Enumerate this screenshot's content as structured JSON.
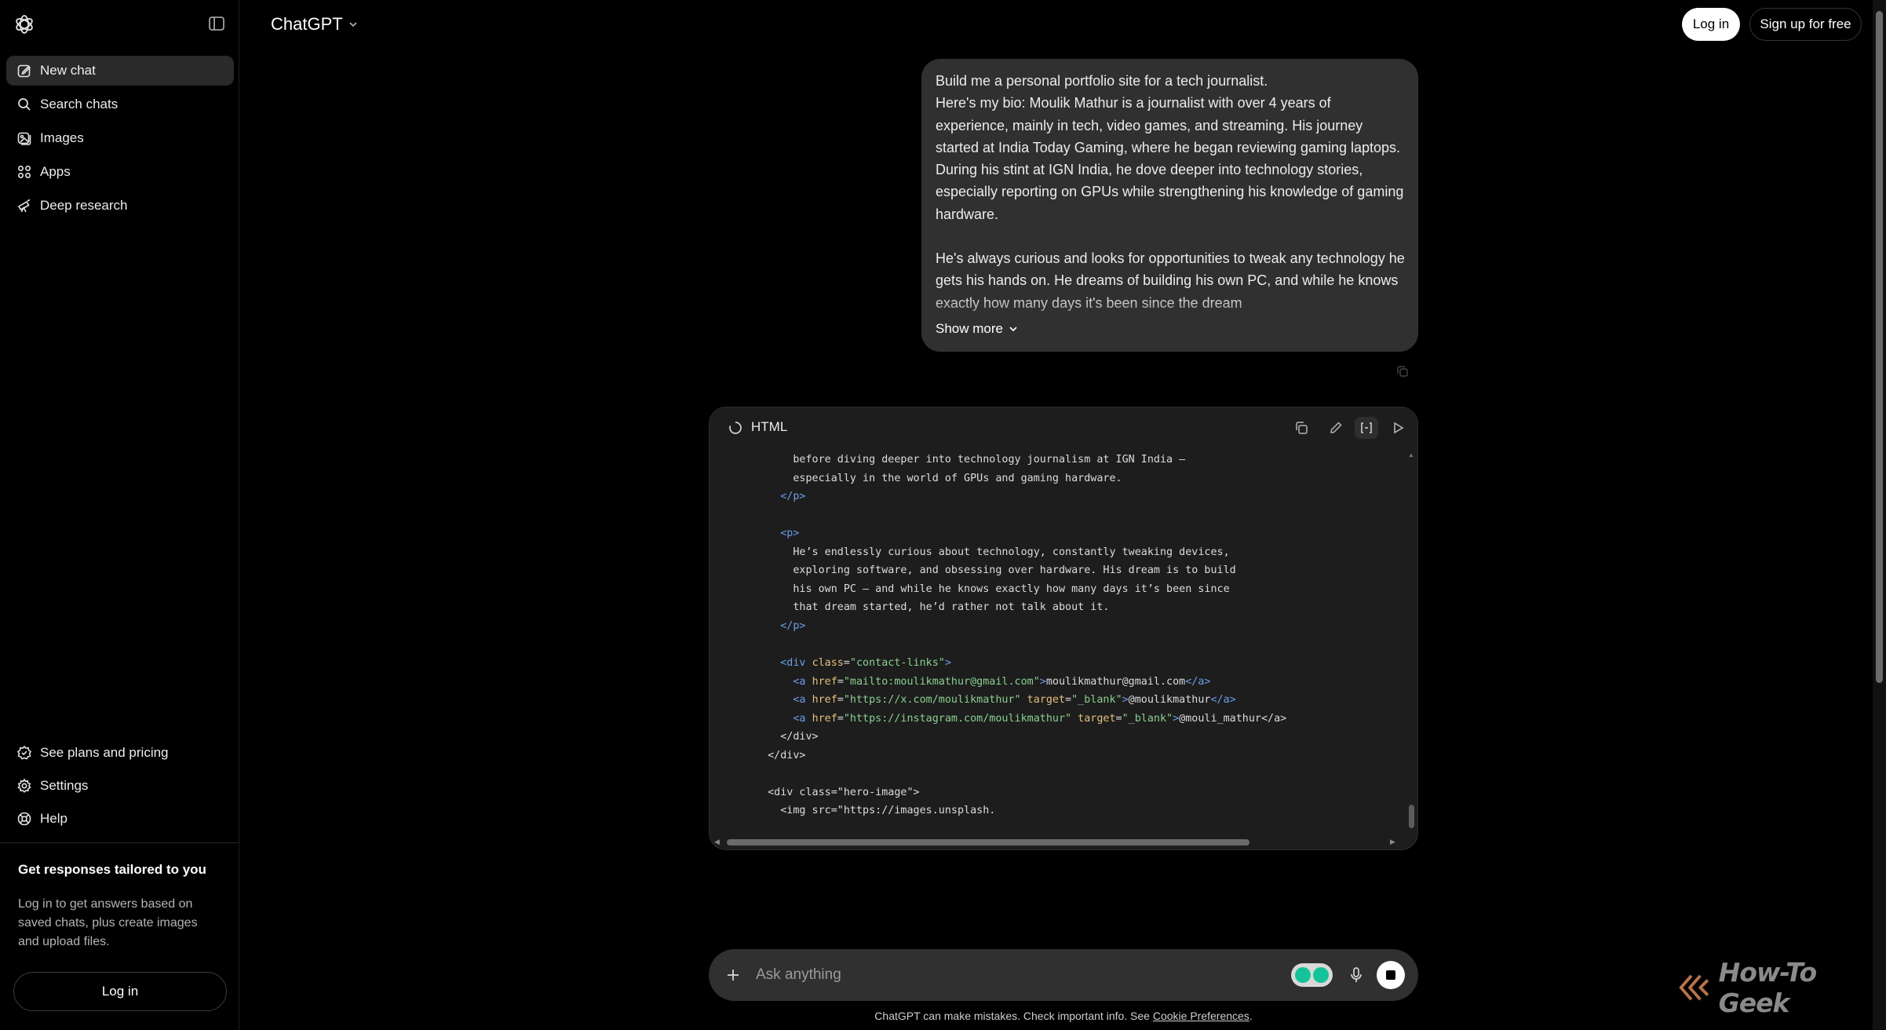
{
  "sidebar": {
    "logo_icon": "chatgpt-logo-icon",
    "toggle_icon": "sidebar-toggle-icon",
    "items": [
      {
        "label": "New chat",
        "icon": "edit-icon"
      },
      {
        "label": "Search chats",
        "icon": "search-icon"
      },
      {
        "label": "Images",
        "icon": "images-icon"
      },
      {
        "label": "Apps",
        "icon": "apps-icon"
      },
      {
        "label": "Deep research",
        "icon": "telescope-icon"
      }
    ],
    "bottom_items": [
      {
        "label": "See plans and pricing",
        "icon": "plans-icon"
      },
      {
        "label": "Settings",
        "icon": "gear-icon"
      },
      {
        "label": "Help",
        "icon": "help-icon"
      }
    ],
    "promo": {
      "title": "Get responses tailored to you",
      "body": "Log in to get answers based on saved chats, plus create images and upload files.",
      "login_label": "Log in"
    }
  },
  "header": {
    "title": "ChatGPT",
    "login_label": "Log in",
    "signup_label": "Sign up for free"
  },
  "user_message": {
    "paragraphs": [
      "Build me a personal portfolio site for a tech journalist.\nHere's my bio: Moulik Mathur is a journalist with over 4 years of experience, mainly in tech, video games, and streaming. His journey started at India Today Gaming, where he began reviewing gaming laptops. During his stint at IGN India, he dove deeper into technology stories, especially reporting on GPUs while strengthening his knowledge of gaming hardware.",
      "He's always curious and looks for opportunities to tweak any technology he gets his hands on. He dreams of building his own PC, and while he knows exactly how many days it's been since the dream"
    ],
    "show_more_label": "Show more"
  },
  "code_panel": {
    "language": "HTML",
    "lines": [
      [
        {
          "t": "txt",
          "v": "      before diving deeper into technology journalism at IGN India —"
        }
      ],
      [
        {
          "t": "txt",
          "v": "      especially in the world of GPUs and gaming hardware."
        }
      ],
      [
        {
          "t": "tag",
          "v": "    </p>"
        }
      ],
      [],
      [
        {
          "t": "tag",
          "v": "    <p>"
        }
      ],
      [
        {
          "t": "txt",
          "v": "      He’s endlessly curious about technology, constantly tweaking devices,"
        }
      ],
      [
        {
          "t": "txt",
          "v": "      exploring software, and obsessing over hardware. His dream is to build"
        }
      ],
      [
        {
          "t": "txt",
          "v": "      his own PC — and while he knows exactly how many days it’s been since"
        }
      ],
      [
        {
          "t": "txt",
          "v": "      that dream started, he’d rather not talk about it."
        }
      ],
      [
        {
          "t": "tag",
          "v": "    </p>"
        }
      ],
      [],
      [
        {
          "t": "tag",
          "v": "    <div "
        },
        {
          "t": "attr",
          "v": "class"
        },
        {
          "t": "txt",
          "v": "="
        },
        {
          "t": "str",
          "v": "\"contact-links\""
        },
        {
          "t": "tag",
          "v": ">"
        }
      ],
      [
        {
          "t": "tag",
          "v": "      <a "
        },
        {
          "t": "attr",
          "v": "href"
        },
        {
          "t": "txt",
          "v": "="
        },
        {
          "t": "str",
          "v": "\"mailto:moulikmathur@gmail.com\""
        },
        {
          "t": "tag",
          "v": ">"
        },
        {
          "t": "txt",
          "v": "moulikmathur@gmail.com"
        },
        {
          "t": "tag",
          "v": "</a>"
        }
      ],
      [
        {
          "t": "tag",
          "v": "      <a "
        },
        {
          "t": "attr",
          "v": "href"
        },
        {
          "t": "txt",
          "v": "="
        },
        {
          "t": "str",
          "v": "\"https://x.com/moulikmathur\""
        },
        {
          "t": "txt",
          "v": " "
        },
        {
          "t": "attr",
          "v": "target"
        },
        {
          "t": "txt",
          "v": "="
        },
        {
          "t": "str",
          "v": "\"_blank\""
        },
        {
          "t": "tag",
          "v": ">"
        },
        {
          "t": "txt",
          "v": "@moulikmathur"
        },
        {
          "t": "tag",
          "v": "</a>"
        }
      ],
      [
        {
          "t": "tag",
          "v": "      <a "
        },
        {
          "t": "attr",
          "v": "href"
        },
        {
          "t": "txt",
          "v": "="
        },
        {
          "t": "str",
          "v": "\"https://instagram.com/moulikmathur\""
        },
        {
          "t": "txt",
          "v": " "
        },
        {
          "t": "attr",
          "v": "target"
        },
        {
          "t": "txt",
          "v": "="
        },
        {
          "t": "str",
          "v": "\"_blank\""
        },
        {
          "t": "tag",
          "v": ">"
        },
        {
          "t": "txt",
          "v": "@mouli_mathur</a>"
        }
      ],
      [
        {
          "t": "txt",
          "v": "    </div>"
        }
      ],
      [
        {
          "t": "txt",
          "v": "  </div>"
        }
      ],
      [],
      [
        {
          "t": "txt",
          "v": "  <div class=\"hero-image\">"
        }
      ],
      [
        {
          "t": "txt",
          "v": "    <img src=\"https://images.unsplash."
        }
      ]
    ]
  },
  "composer": {
    "placeholder": "Ask anything",
    "plus_icon": "plus-icon",
    "extension_icon": "grammarly-icon",
    "mic_icon": "microphone-icon",
    "stop_icon": "stop-icon"
  },
  "footer": {
    "disclaimer": "ChatGPT can make mistakes. Check important info. See ",
    "link": "Cookie Preferences",
    "end": "."
  },
  "watermark": {
    "text": "How-To Geek"
  },
  "colors": {
    "background": "#000000",
    "bubble": "#303030",
    "code_bg": "#1d1d1d",
    "tag": "#6b9ee8",
    "attr": "#e4c07a",
    "string": "#89d08f"
  }
}
